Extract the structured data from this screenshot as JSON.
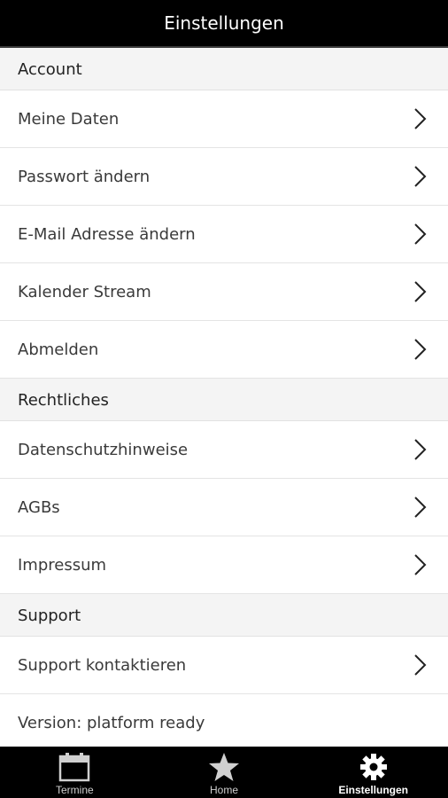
{
  "header": {
    "title": "Einstellungen"
  },
  "sections": [
    {
      "title": "Account",
      "items": [
        "Meine Daten",
        "Passwort ändern",
        "E-Mail Adresse ändern",
        "Kalender Stream",
        "Abmelden"
      ]
    },
    {
      "title": "Rechtliches",
      "items": [
        "Datenschutzhinweise",
        "AGBs",
        "Impressum"
      ]
    },
    {
      "title": "Support",
      "items": [
        "Support kontaktieren"
      ]
    }
  ],
  "version_text": "Version: platform ready",
  "tabs": [
    {
      "label": "Termine",
      "icon": "calendar-icon",
      "active": false
    },
    {
      "label": "Home",
      "icon": "star-icon",
      "active": false
    },
    {
      "label": "Einstellungen",
      "icon": "gear-icon",
      "active": true
    }
  ],
  "colors": {
    "header_bg": "#000000",
    "tabbar_bg": "#000000",
    "section_bg": "#f4f4f4",
    "row_bg": "#ffffff"
  }
}
